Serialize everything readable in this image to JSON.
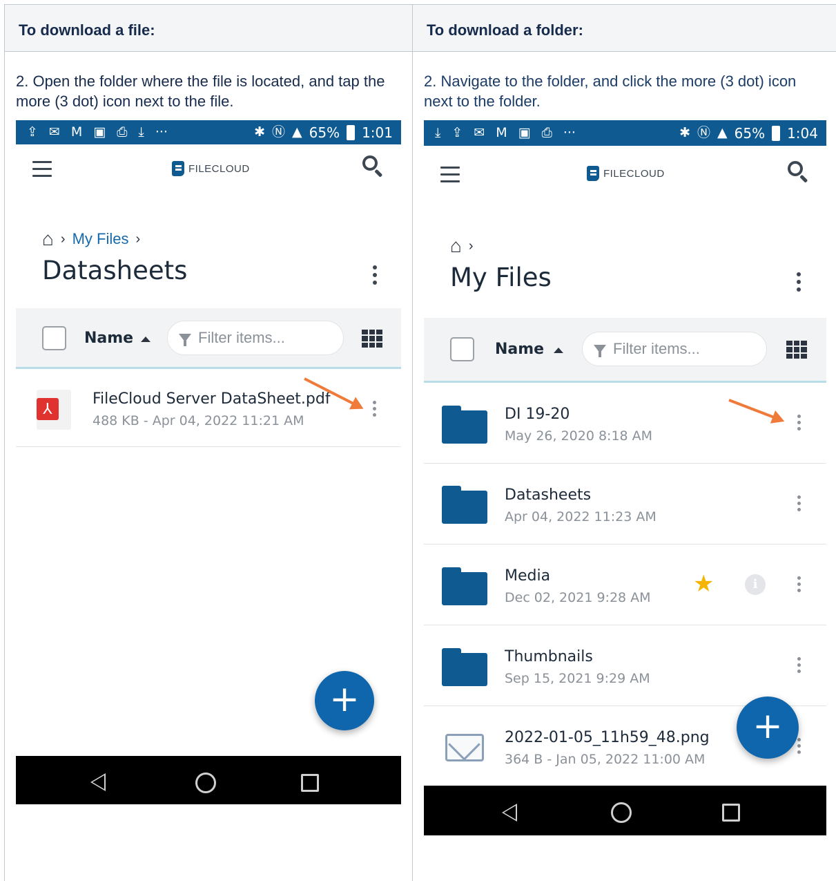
{
  "left": {
    "header": "To download a file:",
    "caption": "2. Open the folder where the file is located, and tap the more (3 dot) icon next to the file.",
    "status": {
      "icons_left": [
        "upload-icon",
        "sms-icon",
        "gmail-icon",
        "book-icon",
        "printer-icon",
        "download-icon"
      ],
      "more": "···",
      "battery": "65%",
      "time": "1:01"
    },
    "logo": "FILECLOUD",
    "breadcrumb": {
      "link": "My Files"
    },
    "title": "Datasheets",
    "list": {
      "name_label": "Name",
      "filter_placeholder": "Filter items..."
    },
    "files": [
      {
        "name": "FileCloud Server DataSheet.pdf",
        "meta": "488 KB - Apr 04, 2022 11:21 AM",
        "icon": "pdf-icon"
      }
    ],
    "fab": "+"
  },
  "right": {
    "header": "To download a folder:",
    "caption": "2. Navigate to the folder, and click the more (3 dot) icon next to the folder.",
    "status": {
      "more": "···",
      "battery": "65%",
      "time": "1:04"
    },
    "logo": "FILECLOUD",
    "title": "My Files",
    "list": {
      "name_label": "Name",
      "filter_placeholder": "Filter items..."
    },
    "items": [
      {
        "name": "DI 19-20",
        "meta": "May 26, 2020 8:18 AM",
        "icon": "folder-icon"
      },
      {
        "name": "Datasheets",
        "meta": "Apr 04, 2022 11:23 AM",
        "icon": "folder-icon"
      },
      {
        "name": "Media",
        "meta": "Dec 02, 2021 9:28 AM",
        "icon": "folder-icon",
        "starred": true
      },
      {
        "name": "Thumbnails",
        "meta": "Sep 15, 2021 9:29 AM",
        "icon": "folder-icon"
      },
      {
        "name": "2022-01-05_11h59_48.png",
        "meta": "364 B - Jan 05, 2022 11:00 AM",
        "icon": "image-file-icon"
      }
    ],
    "fab": "+"
  },
  "colors": {
    "statusbar": "#0f5a91",
    "accent": "#1769aa",
    "folder": "#0f5a91",
    "arrow": "#f07a3a",
    "star": "#f5b400"
  }
}
